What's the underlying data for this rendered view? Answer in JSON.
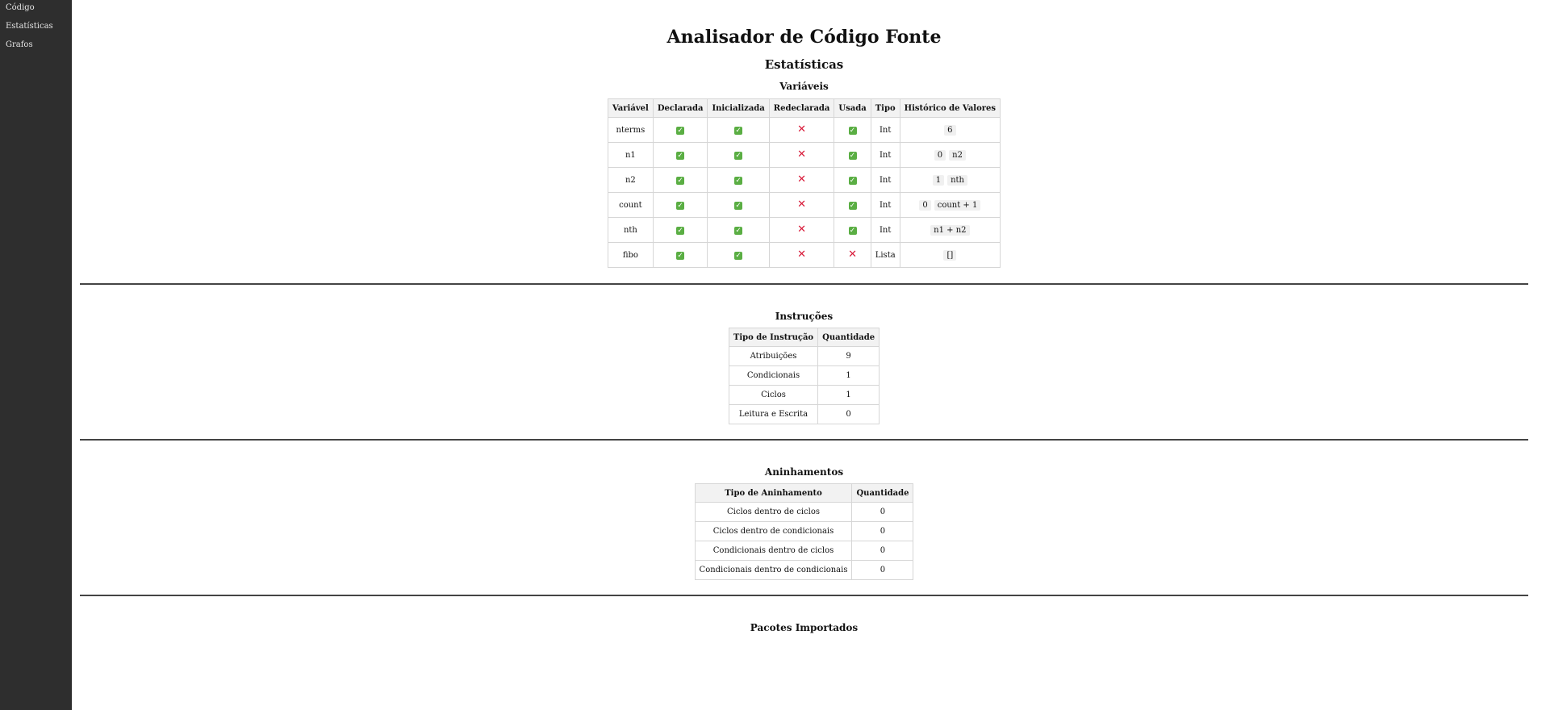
{
  "sidebar": {
    "items": [
      {
        "label": "Código"
      },
      {
        "label": "Estatísticas"
      },
      {
        "label": "Grafos"
      }
    ]
  },
  "page": {
    "title": "Analisador de Código Fonte",
    "subtitle": "Estatísticas"
  },
  "variables": {
    "heading": "Variáveis",
    "headers": [
      "Variável",
      "Declarada",
      "Inicializada",
      "Redeclarada",
      "Usada",
      "Tipo",
      "Histórico de Valores"
    ],
    "rows": [
      {
        "name": "nterms",
        "declared": true,
        "initialized": true,
        "redeclared": false,
        "used": true,
        "type": "Int",
        "history": [
          "6"
        ]
      },
      {
        "name": "n1",
        "declared": true,
        "initialized": true,
        "redeclared": false,
        "used": true,
        "type": "Int",
        "history": [
          "0",
          "n2"
        ]
      },
      {
        "name": "n2",
        "declared": true,
        "initialized": true,
        "redeclared": false,
        "used": true,
        "type": "Int",
        "history": [
          "1",
          "nth"
        ]
      },
      {
        "name": "count",
        "declared": true,
        "initialized": true,
        "redeclared": false,
        "used": true,
        "type": "Int",
        "history": [
          "0",
          "count + 1"
        ]
      },
      {
        "name": "nth",
        "declared": true,
        "initialized": true,
        "redeclared": false,
        "used": true,
        "type": "Int",
        "history": [
          "n1 + n2"
        ]
      },
      {
        "name": "fibo",
        "declared": true,
        "initialized": true,
        "redeclared": false,
        "used": false,
        "type": "Lista",
        "history": [
          "[]"
        ]
      }
    ]
  },
  "instructions": {
    "heading": "Instruções",
    "headers": [
      "Tipo de Instrução",
      "Quantidade"
    ],
    "rows": [
      [
        "Atribuições",
        "9"
      ],
      [
        "Condicionais",
        "1"
      ],
      [
        "Ciclos",
        "1"
      ],
      [
        "Leitura e Escrita",
        "0"
      ]
    ]
  },
  "nesting": {
    "heading": "Aninhamentos",
    "headers": [
      "Tipo de Aninhamento",
      "Quantidade"
    ],
    "rows": [
      [
        "Ciclos dentro de ciclos",
        "0"
      ],
      [
        "Ciclos dentro de condicionais",
        "0"
      ],
      [
        "Condicionais dentro de ciclos",
        "0"
      ],
      [
        "Condicionais dentro de condicionais",
        "0"
      ]
    ]
  },
  "packages": {
    "heading": "Pacotes Importados"
  },
  "icons": {
    "check": "check-icon",
    "cross": "cross-icon"
  },
  "colors": {
    "check": "#5aae43",
    "cross": "#d81b3a",
    "sidebar": "#2e2e2e"
  }
}
